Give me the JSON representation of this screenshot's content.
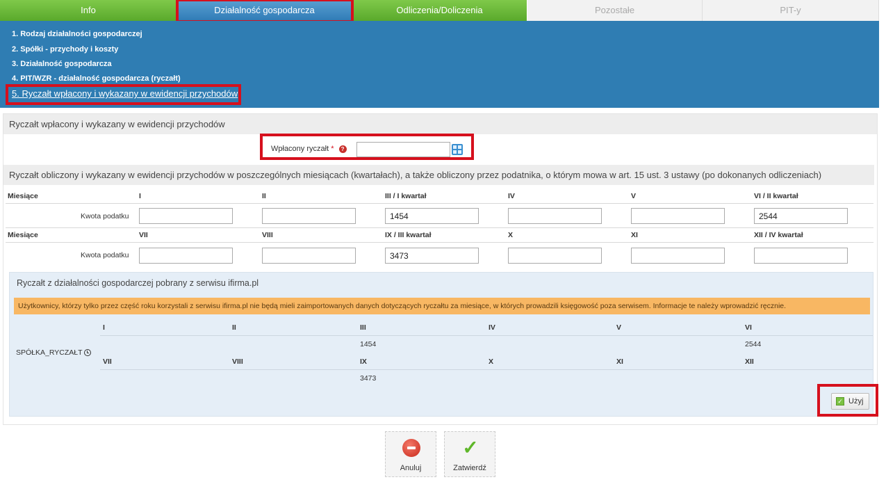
{
  "tabs": [
    {
      "label": "Info"
    },
    {
      "label": "Działalność gospodarcza"
    },
    {
      "label": "Odliczenia/Doliczenia"
    },
    {
      "label": "Pozostałe"
    },
    {
      "label": "PIT-y"
    }
  ],
  "submenu": [
    {
      "label": "1. Rodzaj działalności gospodarczej"
    },
    {
      "label": "2. Spółki - przychody i koszty"
    },
    {
      "label": "3. Działalność gospodarcza"
    },
    {
      "label": "4. PIT/WZR - działalność gospodarcza (ryczałt)"
    },
    {
      "label": "5. Ryczałt wpłacony i wykazany w ewidencji przychodów"
    }
  ],
  "section1": {
    "title": "Ryczałt wpłacony i wykazany w ewidencji przychodów",
    "field_label": "Wpłacony ryczałt",
    "required_mark": "*",
    "help_icon": "?",
    "field_value": ""
  },
  "section2": {
    "title": "Ryczałt obliczony i wykazany w ewidencji przychodów w poszczególnych miesiącach (kwartałach), a także obliczony przez podatnika, o którym mowa w art. 15 ust. 3 ustawy (po dokonanych odliczeniach)",
    "months_label": "Miesiące",
    "amount_label": "Kwota podatku",
    "row1_months": [
      "I",
      "II",
      "III / I kwartał",
      "IV",
      "V",
      "VI / II kwartał"
    ],
    "row1_values": [
      "",
      "",
      "1454",
      "",
      "",
      "2544"
    ],
    "row2_months": [
      "VII",
      "VIII",
      "IX / III kwartał",
      "X",
      "XI",
      "XII / IV kwartał"
    ],
    "row2_values": [
      "",
      "",
      "3473",
      "",
      "",
      ""
    ]
  },
  "imported": {
    "title": "Ryczałt z działalności gospodarczej pobrany z serwisu ifirma.pl",
    "warning": "Użytkownicy, którzy tylko przez część roku korzystali z serwisu ifirma.pl nie będą mieli zaimportowanych danych dotyczących ryczałtu za miesiące, w których prowadzili księgowość poza serwisem. Informacje te należy wprowadzić ręcznie.",
    "company": "SPÓŁKA_RYCZAŁT",
    "row1_months": [
      "I",
      "II",
      "III",
      "IV",
      "V",
      "VI"
    ],
    "row1_values": [
      "",
      "",
      "1454",
      "",
      "",
      "2544"
    ],
    "row2_months": [
      "VII",
      "VIII",
      "IX",
      "X",
      "XI",
      "XII"
    ],
    "row2_values": [
      "",
      "",
      "3473",
      "",
      "",
      ""
    ],
    "use_button": "Użyj"
  },
  "actions": {
    "cancel": "Anuluj",
    "confirm": "Zatwierdź"
  },
  "colors": {
    "tab_green": "#5aa92c",
    "tab_active": "#2f7bb6",
    "submenu_bg": "#2f7db3",
    "highlight_red": "#d6101d",
    "warning_bg": "#f8b763"
  }
}
